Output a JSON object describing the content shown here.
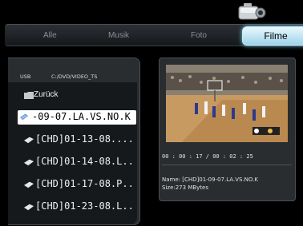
{
  "tabs": {
    "alle": "Alle",
    "musik": "Musik",
    "foto": "Foto",
    "filme": "Filme"
  },
  "path": {
    "source": "USB",
    "folder": "C:/DVD/VIDEO_TS"
  },
  "list": {
    "back": "Zurück",
    "selected": "-09-07.LA.VS.NO.K",
    "items": [
      "[CHD]01-13-08....",
      "[CHD]01-14-08.L..",
      "[CHD]01-17-08.P..",
      "[CHD]01-23-08.L.."
    ]
  },
  "preview": {
    "timecode": "00 : 00 : 17 / 00 : 02 : 25",
    "name": "Name: [CHD]01-09-07.LA.VS.NO.K",
    "size": "Size:273 MBytes"
  },
  "icons": {
    "camera": "video-camera-icon",
    "folder": "folder-icon",
    "file": "video-file-icon"
  },
  "colors": {
    "active_tab": "#bfe6f5",
    "panel": "#2a2d30",
    "list_bg": "#16191c"
  }
}
